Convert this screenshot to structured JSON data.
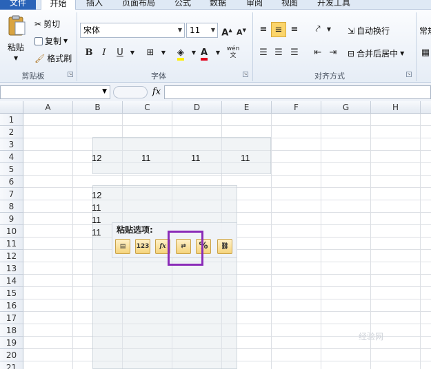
{
  "tabs": [
    "文件",
    "开始",
    "插入",
    "页面布局",
    "公式",
    "数据",
    "审阅",
    "视图",
    "开发工具"
  ],
  "clipboard": {
    "paste": "粘贴",
    "cut": "剪切",
    "copy": "复制",
    "format_painter": "格式刷",
    "label": "剪贴板"
  },
  "font": {
    "name": "宋体",
    "size": "11",
    "label": "字体",
    "bold": "B",
    "italic": "I",
    "underline": "U",
    "phonetic": "wén"
  },
  "alignment": {
    "wrap": "自动换行",
    "merge": "合并后居中",
    "label": "对齐方式"
  },
  "number": {
    "format": "常规"
  },
  "formula_bar": {
    "fx": "fx",
    "name_box": "",
    "value": ""
  },
  "columns": [
    "A",
    "B",
    "C",
    "D",
    "E",
    "F",
    "G",
    "H"
  ],
  "rows": [
    "1",
    "2",
    "3",
    "4",
    "5",
    "6",
    "7",
    "8",
    "9",
    "10",
    "11",
    "12",
    "13",
    "14",
    "15",
    "16",
    "17",
    "18",
    "19",
    "20",
    "21"
  ],
  "cells": {
    "b4": "12",
    "c4": "11",
    "d4": "11",
    "e4": "11",
    "b7": "12",
    "b8": "11",
    "b9": "11",
    "b10": "11"
  },
  "paste_options": {
    "title": "粘贴选项:",
    "values": "123",
    "formula": "fx",
    "percent": "%"
  },
  "watermark": "经验网"
}
